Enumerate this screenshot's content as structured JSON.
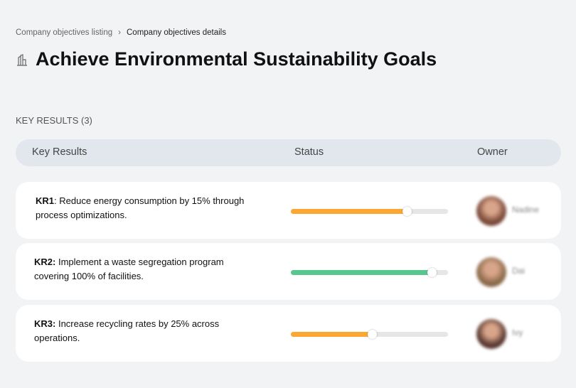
{
  "breadcrumb": {
    "parent": "Company objectives listing",
    "current": "Company objectives details"
  },
  "title": "Achieve Environmental Sustainability Goals",
  "key_results_heading": "KEY RESULTS (3)",
  "table": {
    "headers": {
      "key_results": "Key Results",
      "status": "Status",
      "owner": "Owner"
    },
    "rows": [
      {
        "id": "KR1",
        "text": ": Reduce energy consumption by 15% through process optimizations.",
        "progress": 74,
        "color": "#fba733",
        "owner": "Nadine",
        "avatar": "#7a4a3a"
      },
      {
        "id": "KR2:",
        "text": " Implement a waste segregation program covering 100% of facilities.",
        "progress": 90,
        "color": "#58c68f",
        "owner": "Dai",
        "avatar": "#8a6a4a"
      },
      {
        "id": "KR3:",
        "text": " Increase recycling rates by 25% across operations.",
        "progress": 52,
        "color": "#fba733",
        "owner": "Ivy",
        "avatar": "#5a3a32"
      }
    ]
  }
}
